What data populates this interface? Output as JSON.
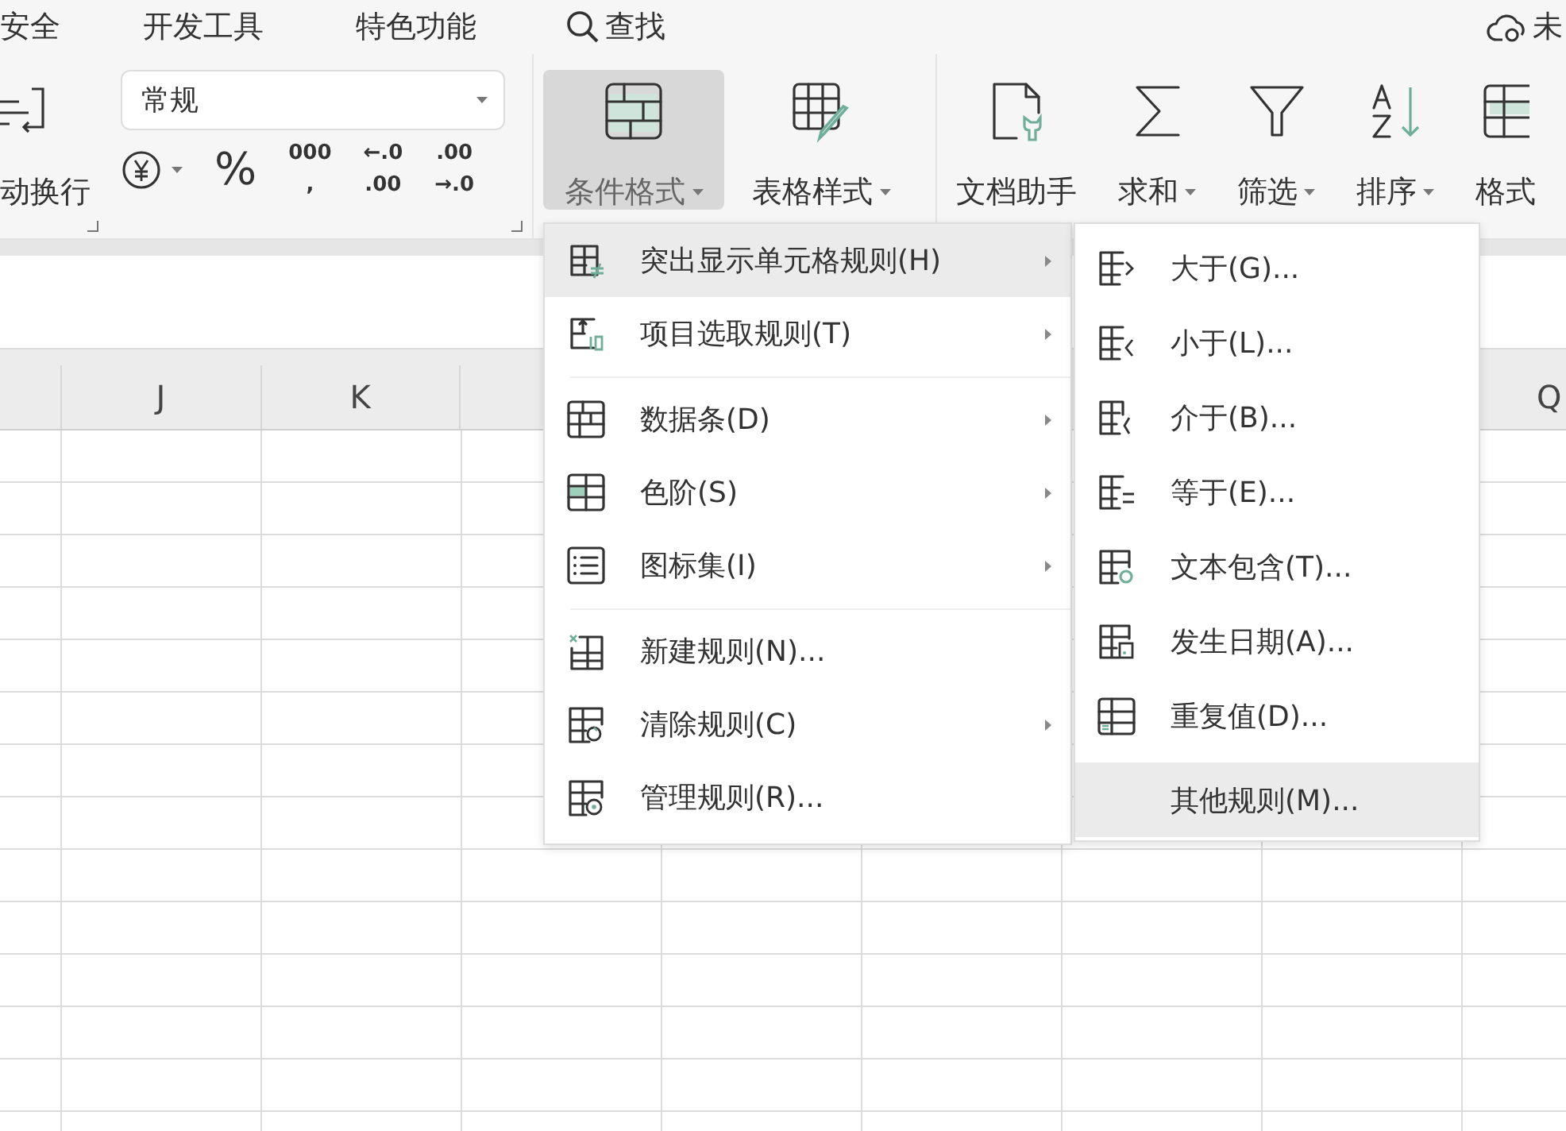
{
  "ribbon_tabs": [
    {
      "label": "安全"
    },
    {
      "label": "开发工具"
    },
    {
      "label": "特色功能"
    }
  ],
  "search": {
    "label": "查找"
  },
  "cloud_status": {
    "label": "未"
  },
  "ribbon": {
    "wrap_button": {
      "label": "动换行"
    },
    "number_format": {
      "value": "常规"
    },
    "number_buttons": [
      {
        "kind": "currency",
        "has_menu": true
      },
      {
        "kind": "text",
        "lines": [
          "%"
        ]
      },
      {
        "kind": "text",
        "lines": [
          "000",
          ","
        ]
      },
      {
        "kind": "text",
        "lines": [
          "←.0",
          ".00"
        ]
      },
      {
        "kind": "text",
        "lines": [
          ".00",
          "→.0"
        ]
      }
    ],
    "style_buttons": [
      {
        "kind": "conditional",
        "label": "条件格式",
        "has_menu": true,
        "selected": true
      },
      {
        "kind": "table_style",
        "label": "表格样式",
        "has_menu": true,
        "selected": false
      }
    ],
    "edit_buttons": [
      {
        "kind": "doc_helper",
        "label": "文档助手",
        "has_menu": false,
        "selected": false
      },
      {
        "kind": "sum",
        "label": "求和",
        "has_menu": true,
        "selected": false
      },
      {
        "kind": "filter",
        "label": "筛选",
        "has_menu": true,
        "selected": false
      },
      {
        "kind": "sort",
        "label": "排序",
        "has_menu": true,
        "selected": false
      },
      {
        "kind": "format",
        "label": "格式",
        "has_menu": false,
        "selected": false
      }
    ]
  },
  "sheet": {
    "columns_left": [
      {
        "label": "J"
      },
      {
        "label": "K"
      }
    ],
    "columns_right": [
      {
        "label": "Q"
      }
    ]
  },
  "menu": {
    "groups": [
      [
        {
          "kind": "highlight",
          "label": "突出显示单元格规则(H)",
          "submenu": true,
          "selected": true
        },
        {
          "kind": "top10",
          "label": "项目选取规则(T)",
          "submenu": true,
          "selected": false
        }
      ],
      [
        {
          "kind": "databar",
          "label": "数据条(D)",
          "submenu": true,
          "selected": false
        },
        {
          "kind": "colorscale",
          "label": "色阶(S)",
          "submenu": true,
          "selected": false
        },
        {
          "kind": "iconset",
          "label": "图标集(I)",
          "submenu": true,
          "selected": false
        }
      ],
      [
        {
          "kind": "new",
          "label": "新建规则(N)...",
          "submenu": false,
          "selected": false
        },
        {
          "kind": "clear",
          "label": "清除规则(C)",
          "submenu": true,
          "selected": false
        },
        {
          "kind": "manage",
          "label": "管理规则(R)...",
          "submenu": false,
          "selected": false
        }
      ]
    ]
  },
  "submenu": {
    "items": [
      {
        "kind": "greater",
        "label": "大于(G)...",
        "selected": false
      },
      {
        "kind": "less",
        "label": "小于(L)...",
        "selected": false
      },
      {
        "kind": "between",
        "label": "介于(B)...",
        "selected": false
      },
      {
        "kind": "equal",
        "label": "等于(E)...",
        "selected": false
      },
      {
        "kind": "text",
        "label": "文本包含(T)...",
        "selected": false
      },
      {
        "kind": "date",
        "label": "发生日期(A)...",
        "selected": false
      },
      {
        "kind": "duplicate",
        "label": "重复值(D)...",
        "selected": false
      },
      {
        "kind": "none",
        "label": "其他规则(M)...",
        "selected": true
      }
    ]
  }
}
